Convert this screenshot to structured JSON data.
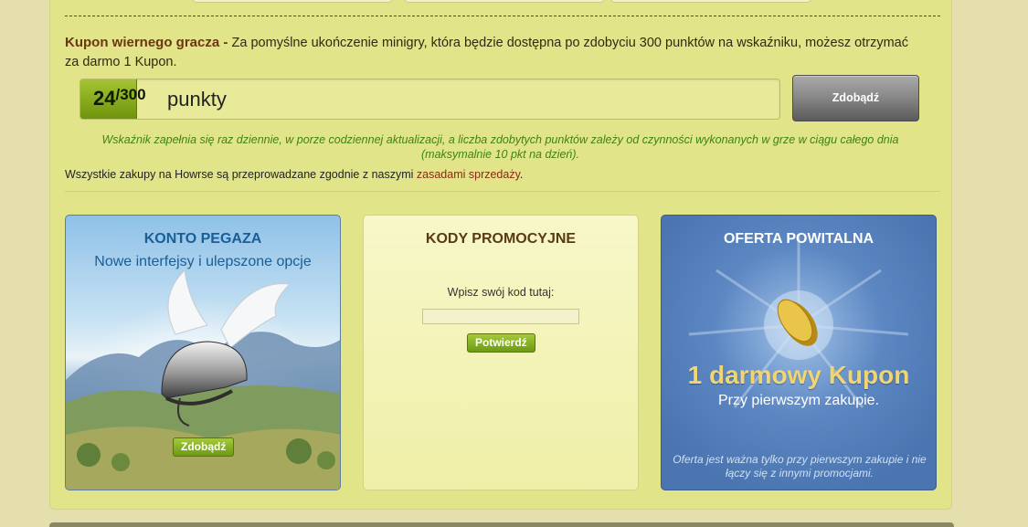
{
  "coupon": {
    "title": "Kupon wiernego gracza",
    "separator": " - ",
    "description": "Za pomyślne ukończenie minigry, która będzie dostępna po zdobyciu 300 punktów na wskaźniku, możesz otrzymać za darmo 1 Kupon."
  },
  "gauge": {
    "current": "24",
    "max": "/300",
    "unit": "punkty",
    "progress": 0.08,
    "button": "Zdobądź"
  },
  "note": "Wskaźnik zapełnia się raz dziennie, w porze codziennej aktualizacji, a liczba zdobytych punktów zależy od czynności wykonanych w grze w ciągu całego dnia (maksymalnie 10 pkt na dzień).",
  "sales": {
    "text": "Wszystkie zakupy na Howrse są przeprowadzane zgodnie z naszymi ",
    "link": "zasadami sprzedaży",
    "end": "."
  },
  "pegasus": {
    "title": "KONTO PEGAZA",
    "subtitle": "Nowe interfejsy i ulepszone opcje",
    "button": "Zdobądź"
  },
  "promo": {
    "title": "KODY PROMOCYJNE",
    "label": "Wpisz swój kod tutaj:",
    "input_value": "",
    "button": "Potwierdź"
  },
  "offer": {
    "title": "OFERTA POWITALNA",
    "headline": "1 darmowy Kupon",
    "subline": "Przy pierwszym zakupie.",
    "note": "Oferta jest ważna tylko przy pierwszym zakupie i nie łączy się z innymi promocjami."
  },
  "colors": {
    "panel": "#e2e48a",
    "accent_green": "#7aa318",
    "link": "#8a2a10",
    "offer_blue": "#4a75b0"
  }
}
